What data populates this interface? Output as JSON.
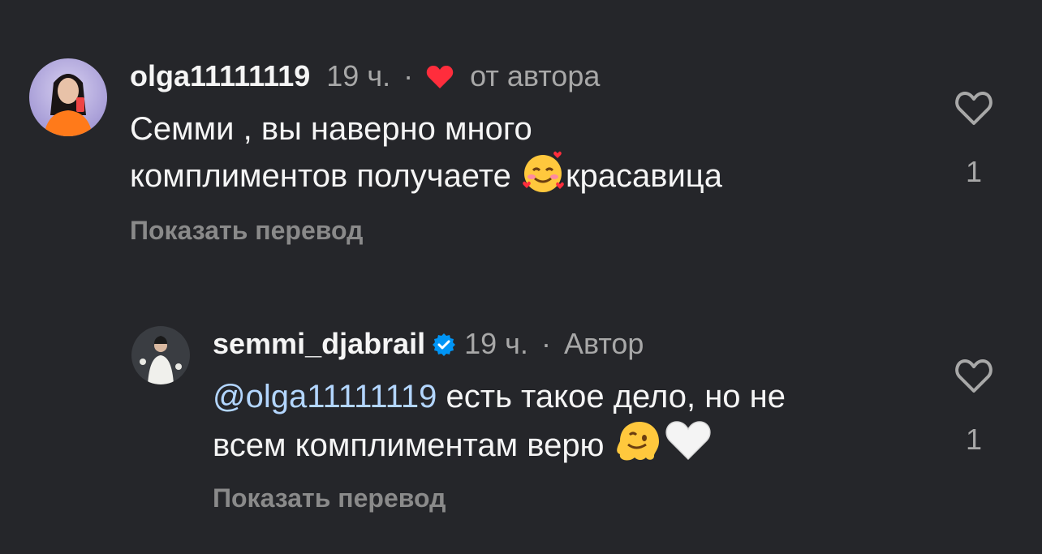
{
  "comments": [
    {
      "username": "olga11111119",
      "time": "19 ч.",
      "separator": "·",
      "author_like_label": "от автора",
      "text_line1": "Семми , вы наверно много",
      "text_line2_a": "комплиментов получаете",
      "text_line2_b": "красавица",
      "emoji_icon": "smiling-face-with-hearts-icon",
      "translate_label": "Показать перевод",
      "like_count": "1"
    },
    {
      "username": "semmi_djabrail",
      "verified": true,
      "time": "19 ч.",
      "separator": "·",
      "author_badge": "Автор",
      "mention": "@olga11111119",
      "text_line1_rest": " есть такое дело, но не",
      "text_line2": "всем комплиментам верю",
      "emoji_icons": [
        "melting-face-icon",
        "white-heart-icon"
      ],
      "translate_label": "Показать перевод",
      "like_count": "1"
    }
  ],
  "colors": {
    "background": "#25262a",
    "text": "#f5f5f5",
    "secondary": "#a8a8a8",
    "mention": "#b3d6ff",
    "heart_red": "#ff2d3c",
    "verified_blue": "#0095f6"
  }
}
